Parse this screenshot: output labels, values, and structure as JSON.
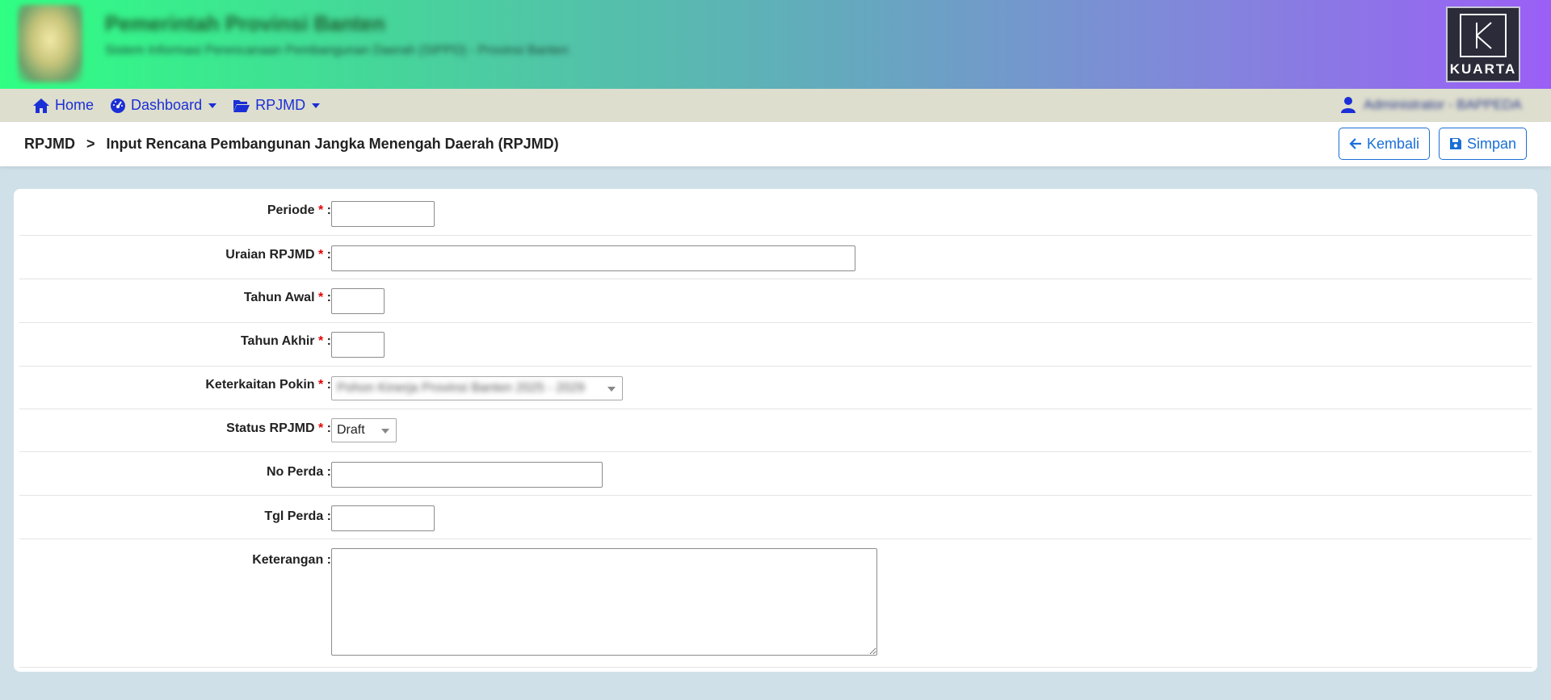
{
  "header": {
    "title": "Pemerintah Provinsi Banten",
    "subtitle": "Sistem Informasi Perencanaan Pembangunan Daerah (SIPPD) - Provinsi Banten",
    "brand": "KUARTA"
  },
  "nav": {
    "items": [
      {
        "label": "Home",
        "icon": "home-icon",
        "dropdown": false
      },
      {
        "label": "Dashboard",
        "icon": "tachometer-icon",
        "dropdown": true
      },
      {
        "label": "RPJMD",
        "icon": "folder-open-icon",
        "dropdown": true
      }
    ],
    "user": "Administrator - BAPPEDA"
  },
  "breadcrumb": {
    "root": "RPJMD",
    "separator": ">",
    "current": "Input Rencana Pembangunan Jangka Menengah Daerah (RPJMD)"
  },
  "actions": {
    "back_label": "Kembali",
    "save_label": "Simpan"
  },
  "form": {
    "required_mark": "*",
    "colon": ":",
    "fields": {
      "periode": {
        "label": "Periode",
        "required": true,
        "value": ""
      },
      "uraian": {
        "label": "Uraian RPJMD",
        "required": true,
        "value": ""
      },
      "tahun_awal": {
        "label": "Tahun Awal",
        "required": true,
        "value": ""
      },
      "tahun_akhir": {
        "label": "Tahun Akhir",
        "required": true,
        "value": ""
      },
      "pokin": {
        "label": "Keterkaitan Pokin",
        "required": true,
        "value": "Pohon Kinerja Provinsi Banten 2025 - 2029"
      },
      "status": {
        "label": "Status RPJMD",
        "required": true,
        "value": "Draft"
      },
      "no_perda": {
        "label": "No Perda",
        "required": false,
        "value": ""
      },
      "tgl_perda": {
        "label": "Tgl Perda",
        "required": false,
        "value": ""
      },
      "keterangan": {
        "label": "Keterangan",
        "required": false,
        "value": ""
      }
    }
  },
  "colors": {
    "accent": "#1a6fd6",
    "nav_link": "#1a2fd6",
    "required": "#e60000",
    "navbar_bg": "#dedece",
    "page_bg": "#d0e0e8"
  }
}
